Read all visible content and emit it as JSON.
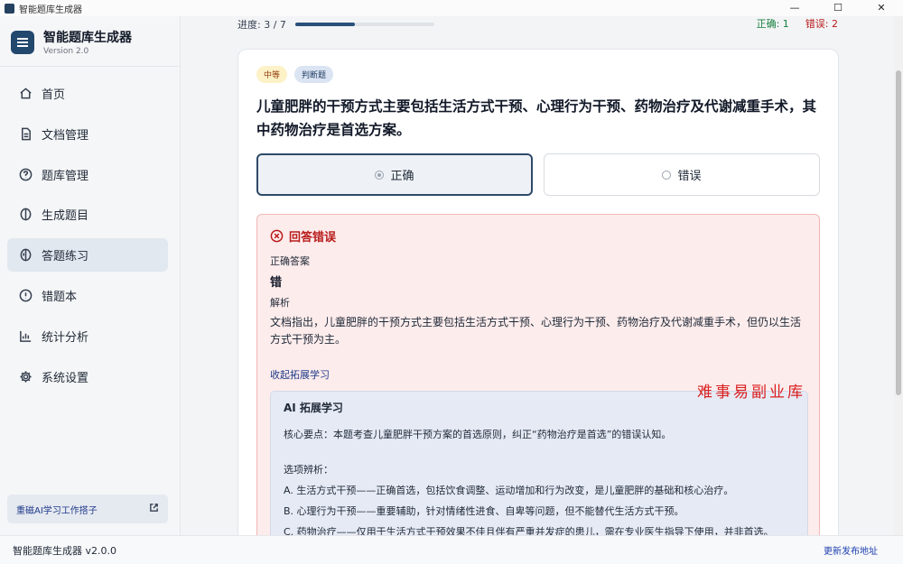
{
  "window": {
    "title": "智能题库生成器",
    "controls": [
      "—",
      "☐",
      "✕"
    ]
  },
  "sidebar": {
    "brand_title": "智能题库生成器",
    "brand_version": "Version 2.0",
    "items": [
      {
        "label": "首页",
        "icon": "home-icon"
      },
      {
        "label": "文档管理",
        "icon": "document-icon"
      },
      {
        "label": "题库管理",
        "icon": "question-circle-icon"
      },
      {
        "label": "生成题目",
        "icon": "sparkle-icon"
      },
      {
        "label": "答题练习",
        "icon": "brain-icon",
        "active": true
      },
      {
        "label": "错题本",
        "icon": "alert-circle-icon"
      },
      {
        "label": "统计分析",
        "icon": "bar-chart-icon"
      },
      {
        "label": "系统设置",
        "icon": "gear-icon"
      }
    ],
    "promo_label": "重磁AI学习工作搭子"
  },
  "status_bar": {
    "app_name": "智能题库生成器 v2.0.0",
    "release_link": "更新发布地址"
  },
  "progress": {
    "label": "进度: 3 / 7",
    "current": 3,
    "total": 7
  },
  "score": {
    "correct_label": "正确: 1",
    "wrong_label": "错误: 2"
  },
  "question": {
    "difficulty_tag": "中等",
    "type_tag": "判断题",
    "text": "儿童肥胖的干预方式主要包括生活方式干预、心理行为干预、药物治疗及代谢减重手术，其中药物治疗是首选方案。",
    "options": [
      {
        "label": "正确",
        "selected": true
      },
      {
        "label": "错误",
        "selected": false
      }
    ]
  },
  "result": {
    "title": "回答错误",
    "correct_answer_label": "正确答案",
    "correct_answer": "错",
    "analysis_label": "解析",
    "analysis_text": "文档指出，儿童肥胖的干预方式主要包括生活方式干预、心理行为干预、药物治疗及代谢减重手术，但仍以生活方式干预为主。",
    "collapse_label": "收起拓展学习"
  },
  "ai_learning": {
    "title": "AI 拓展学习",
    "key_point": "核心要点：本题考查儿童肥胖干预方案的首选原则，纠正“药物治疗是首选”的错误认知。",
    "options_title": "选项辨析：",
    "lines": [
      "A. 生活方式干预——正确首选，包括饮食调整、运动增加和行为改变，是儿童肥胖的基础和核心治疗。",
      "B. 心理行为干预——重要辅助，针对情绪性进食、自卑等问题，但不能替代生活方式干预。",
      "C. 药物治疗——仅用于生活方式干预效果不佳且伴有严重并发症的患儿，需在专业医生指导下使用，并非首选。"
    ]
  },
  "watermark": "难事易副业库",
  "colors": {
    "accent": "#2a4f7a",
    "error": "#b91c1c",
    "success": "#15803d"
  }
}
